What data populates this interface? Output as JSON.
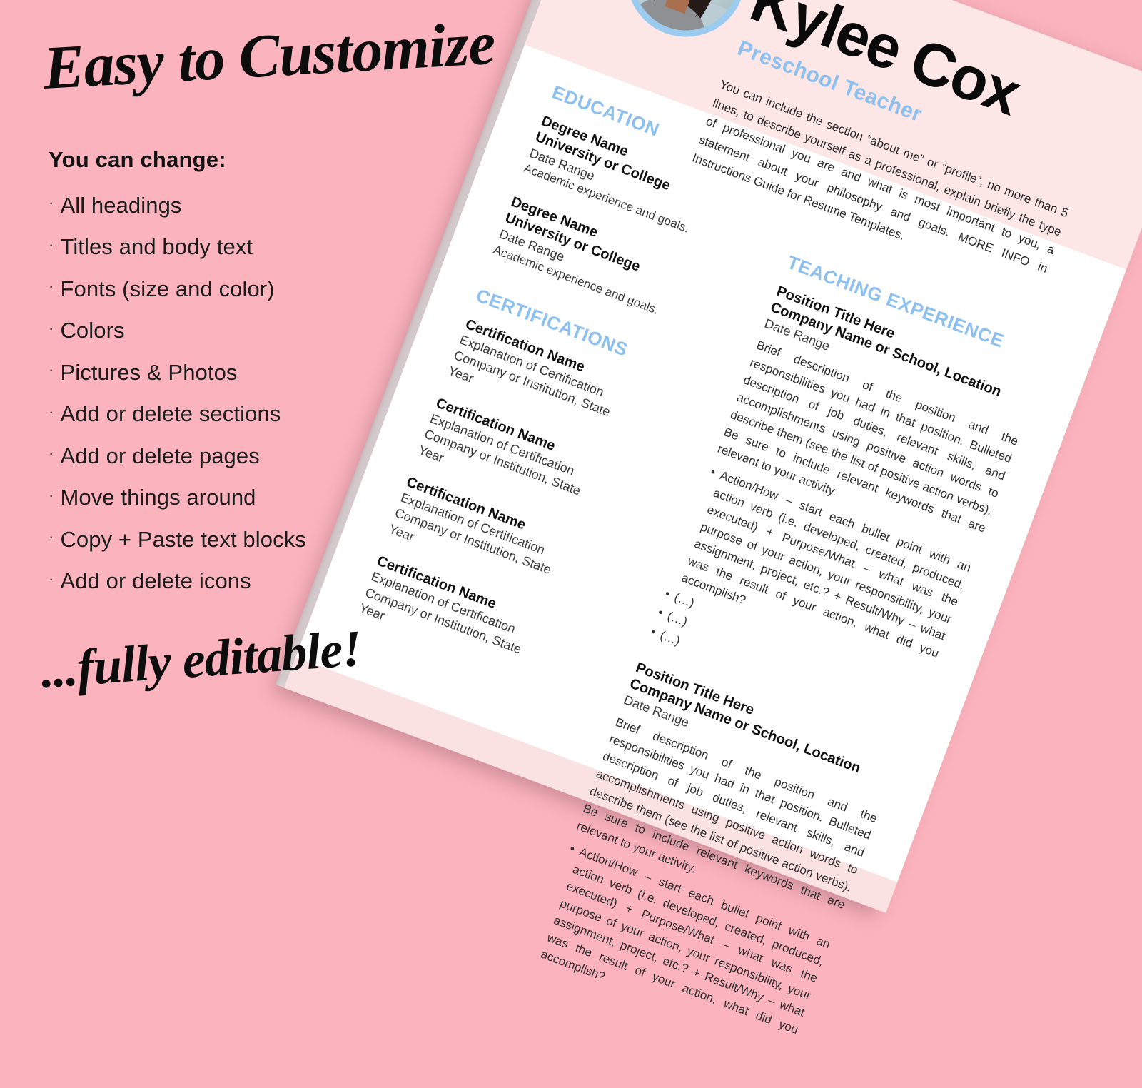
{
  "promo": {
    "headline": "Easy to Customize",
    "subhead": "You can change:",
    "bullet_marker": "·",
    "items": [
      "All headings",
      "Titles and body text",
      "Fonts (size and color)",
      "Colors",
      "Pictures & Photos",
      "Add or delete sections",
      "Add or delete pages",
      "Move things around",
      "Copy + Paste text blocks",
      "Add or delete icons"
    ],
    "footline": "...fully editable!"
  },
  "colors": {
    "background_pink": "#fbb3bd",
    "header_band_pink": "#fce6e6",
    "accent_blue": "#8cc0f0",
    "page_white": "#ffffff",
    "text_dark": "#111111"
  },
  "resume": {
    "name": "Kylee Cox",
    "role": "Preschool Teacher",
    "about": "You can include the section “about me” or “profile”, no more than 5 lines, to describe yourself as a professional, explain briefly the type of professional you are and what is most important to you, a statement about your philosophy and goals. MORE INFO in Instructions Guide for Resume Templates.",
    "avatar_alt": "profile-photo",
    "sections": {
      "education": {
        "title": "EDUCATION",
        "entries": [
          {
            "degree": "Degree Name",
            "school": "University or College",
            "dates": "Date Range",
            "note": "Academic experience and goals."
          },
          {
            "degree": "Degree Name",
            "school": "University or College",
            "dates": "Date Range",
            "note": "Academic experience and goals."
          }
        ]
      },
      "certifications": {
        "title": "CERTIFICATIONS",
        "entries": [
          {
            "name": "Certification Name",
            "explanation": "Explanation of Certification",
            "institution": "Company or Institution, State",
            "year": "Year"
          },
          {
            "name": "Certification Name",
            "explanation": "Explanation of Certification",
            "institution": "Company or Institution, State",
            "year": "Year"
          },
          {
            "name": "Certification Name",
            "explanation": "Explanation of Certification",
            "institution": "Company or Institution, State",
            "year": "Year"
          },
          {
            "name": "Certification Name",
            "explanation": "Explanation of Certification",
            "institution": "Company or Institution, State",
            "year": "Year"
          }
        ]
      },
      "experience": {
        "title": "TEACHING EXPERIENCE",
        "entries": [
          {
            "position": "Position Title Here",
            "company": "Company Name or School, Location",
            "dates": "Date Range",
            "description": "Brief description of the position and the responsibilities you had in that position. Bulleted description of job duties, relevant skills, and accomplishments using positive action words to describe them (see the list of positive action verbs). Be sure to include relevant keywords that are relevant to your activity.",
            "bullets": [
              "Action/How – start each bullet point with an action verb (i.e. developed, created, produced, executed) + Purpose/What – what was the purpose of your action, your responsibility, your assignment, project, etc.? + Result/Why – what was the result of your action, what did you accomplish?",
              "(…)",
              "(…)",
              "(…)"
            ]
          },
          {
            "position": "Position Title Here",
            "company": "Company Name or School, Location",
            "dates": "Date Range",
            "description": "Brief description of the position and the responsibilities you had in that position. Bulleted description of job duties, relevant skills, and accomplishments using positive action words to describe them (see the list of positive action verbs). Be sure to include relevant keywords that are relevant to your activity.",
            "bullets": [
              "Action/How – start each bullet point with an action verb (i.e. developed, created, produced, executed) + Purpose/What – what was the purpose of your action, your responsibility, your assignment, project, etc.? + Result/Why – what was the result of your action, what did you accomplish?"
            ]
          }
        ]
      }
    }
  }
}
